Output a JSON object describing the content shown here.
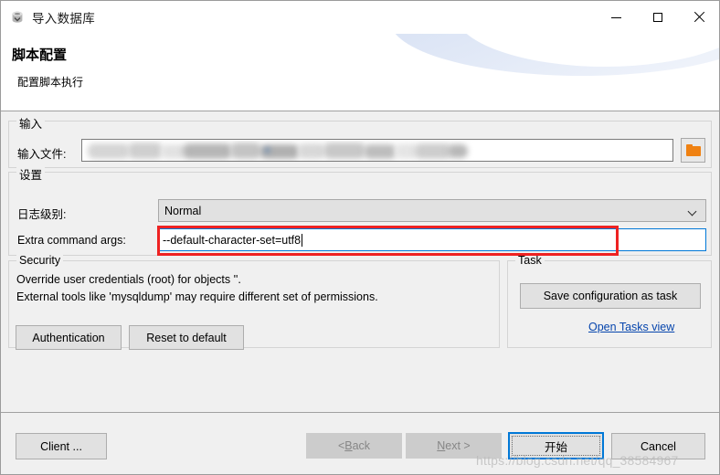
{
  "window": {
    "title": "导入数据库",
    "icon": "database-import-icon",
    "controls": {
      "minimize": "minimize-icon",
      "maximize": "maximize-icon",
      "close": "close-icon"
    }
  },
  "header": {
    "title": "脚本配置",
    "subtitle": "配置脚本执行"
  },
  "input_group": {
    "legend": "输入",
    "file_label": "输入文件:",
    "file_value": "",
    "browse_icon": "folder-icon"
  },
  "settings_group": {
    "legend": "设置",
    "log_level_label": "日志级别:",
    "log_level_value": "Normal",
    "extra_args_label": "Extra command args:",
    "extra_args_value": "--default-character-set=utf8"
  },
  "security_group": {
    "legend": "Security",
    "line1": "Override user credentials (root) for objects ''.",
    "line2": "External tools like 'mysqldump' may require different set of permissions.",
    "auth_button": "Authentication",
    "reset_button": "Reset to default"
  },
  "task_group": {
    "legend": "Task",
    "save_button": "Save configuration as task",
    "open_link": "Open Tasks view"
  },
  "footer": {
    "client_button": "Client ...",
    "back_button_prefix": "< ",
    "back_button_mnemonic": "B",
    "back_button_suffix": "ack",
    "next_button_mnemonic": "N",
    "next_button_suffix": "ext >",
    "start_button": "开始",
    "cancel_button": "Cancel"
  },
  "annotation": {
    "color": "#ee2222"
  },
  "watermark": {
    "text": "https://blog.csdn.net/qq_38584967"
  },
  "colors": {
    "accent": "#0078d7",
    "link": "#0645ad",
    "folder": "#ef8112",
    "dialog_bg": "#f0f0f0",
    "header_bg": "#ffffff"
  }
}
